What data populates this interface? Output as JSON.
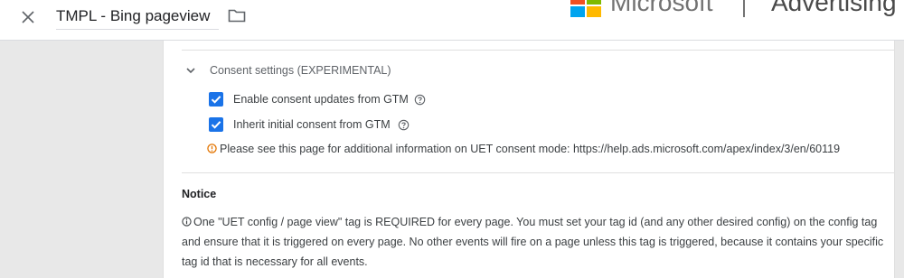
{
  "header": {
    "close_icon": "close-icon",
    "title": "TMPL - Bing pageview",
    "folder_icon": "folder-icon",
    "brand_word": "Microsoft",
    "brand_product": "Advertising",
    "logo_colors": [
      "#f25022",
      "#7fba00",
      "#00a4ef",
      "#ffb900"
    ]
  },
  "consent": {
    "section_title": "Consent settings (EXPERIMENTAL)",
    "checkboxes": [
      {
        "label": "Enable consent updates from GTM",
        "checked": true
      },
      {
        "label": "Inherit initial consent from GTM",
        "checked": true
      }
    ],
    "info_text": "Please see this page for additional information on UET consent mode: https://help.ads.microsoft.com/apex/index/3/en/60119"
  },
  "notice": {
    "title": "Notice",
    "body": "One \"UET config / page view\" tag is REQUIRED for every page. You must set your tag id (and any other desired config) on the config tag and ensure that it is triggered on every page. No other events will fire on a page unless this tag is triggered, because it contains your specific tag id that is necessary for all events."
  },
  "colors": {
    "accent": "#1a73e8",
    "warning": "#e37400"
  }
}
